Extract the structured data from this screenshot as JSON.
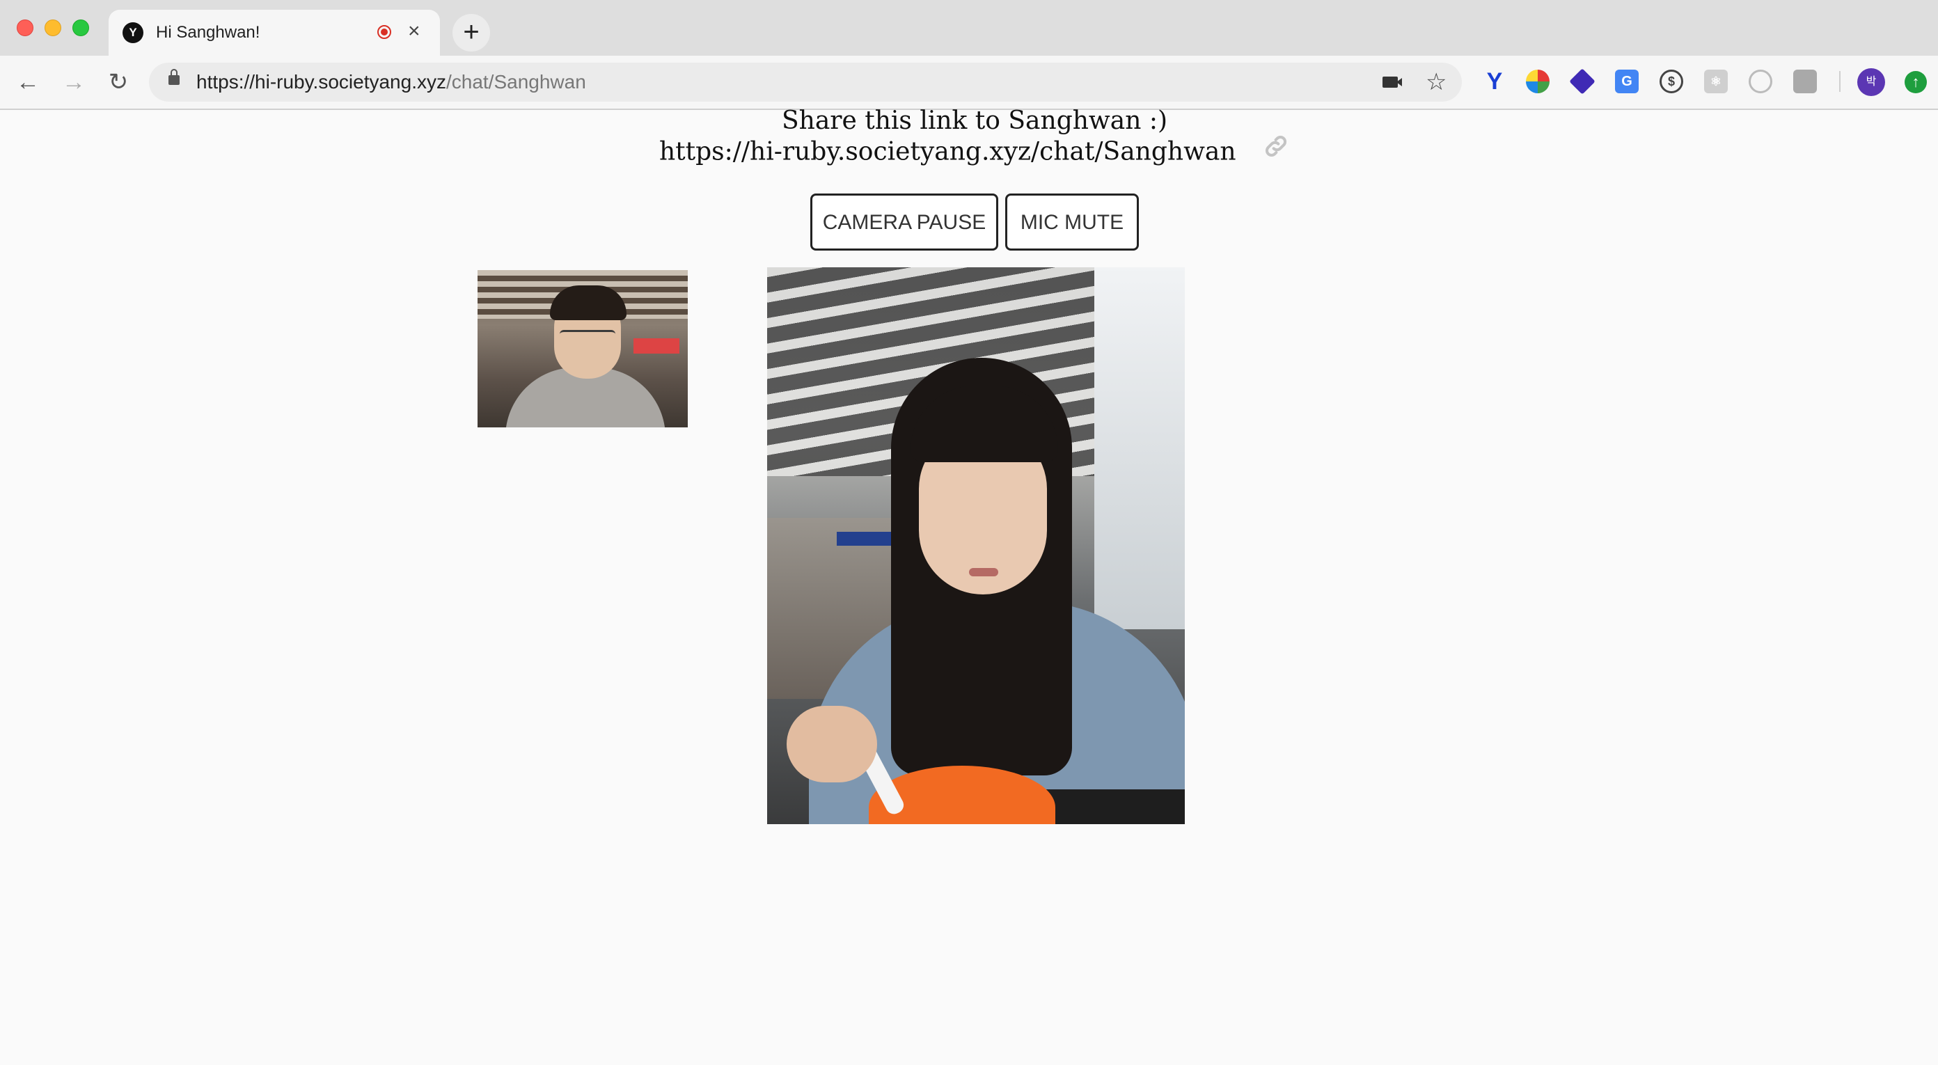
{
  "browser": {
    "tab_title": "Hi Sanghwan!",
    "tab_favicon_letter": "Y",
    "new_tab_glyph": "+",
    "close_glyph": "×",
    "url_host": "https://hi-ruby.societyang.xyz",
    "url_path": "/chat/Sanghwan",
    "profile_initial": "박",
    "icons": [
      "back-arrow-icon",
      "forward-arrow-icon",
      "reload-icon",
      "lock-icon",
      "camera-icon",
      "star-icon",
      "recording-icon"
    ]
  },
  "page": {
    "share_text": "Share this link to Sanghwan :)",
    "share_link": "https://hi-ruby.societyang.xyz/chat/Sanghwan",
    "link_icon": "link-icon",
    "buttons": {
      "camera": "CAMERA PAUSE",
      "mic": "MIC MUTE"
    }
  },
  "colors": {
    "page_background": "#fafafa",
    "recording_indicator": "#d93025",
    "profile_avatar": "#5b36b3"
  }
}
